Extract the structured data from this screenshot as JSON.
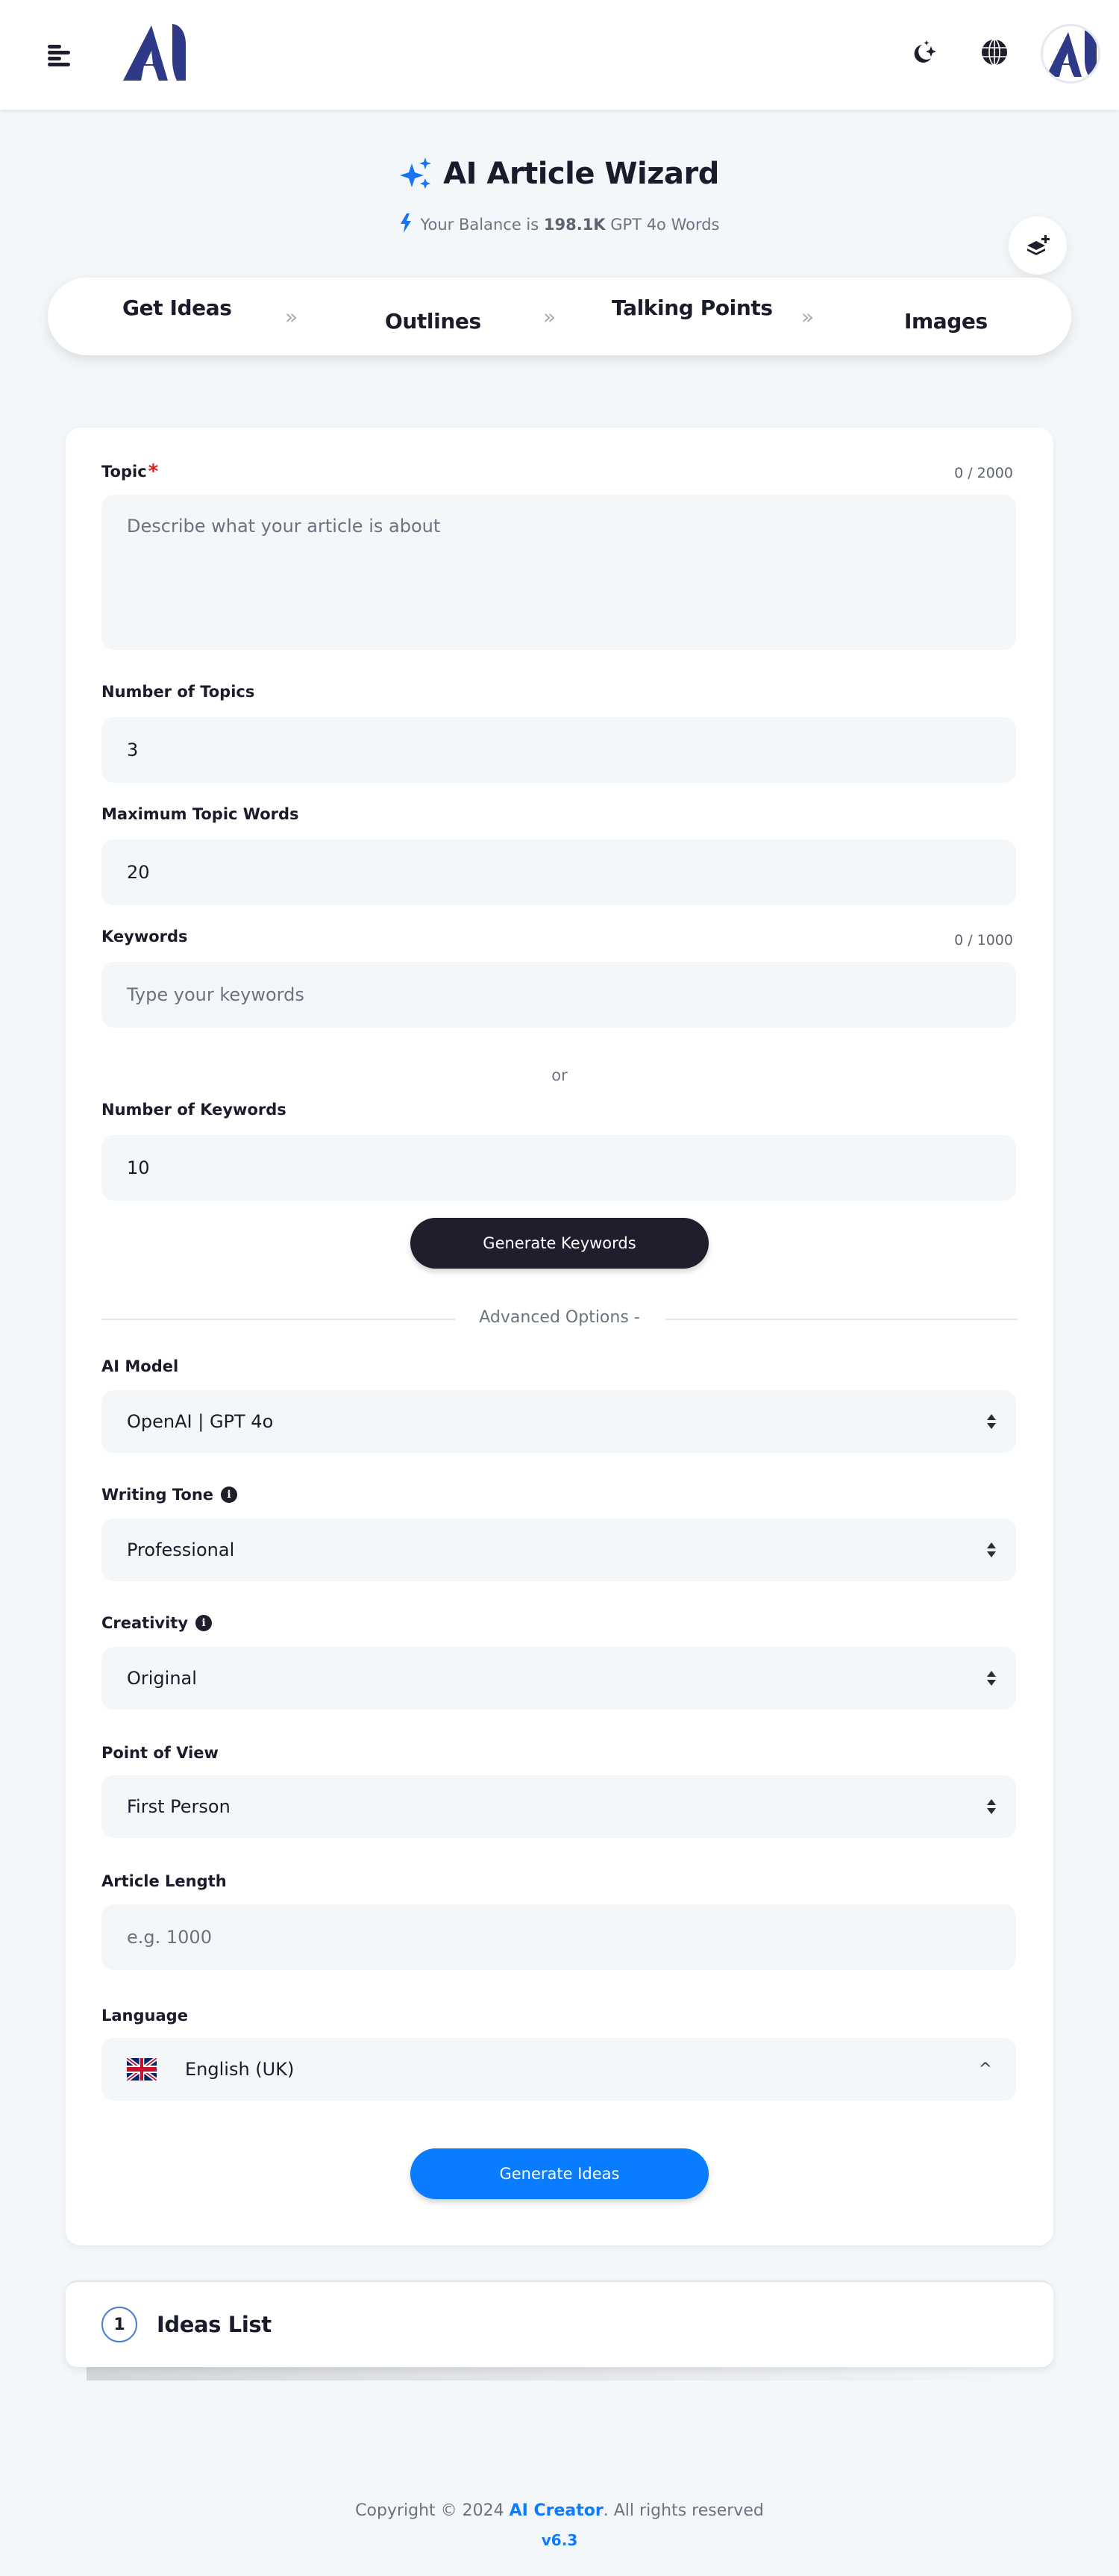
{
  "header": {
    "menu_icon": "hamburger-menu-icon",
    "logo": "ai-creator-logo",
    "theme_icon": "moon-stars-icon",
    "language_icon": "globe-icon",
    "avatar": "user-avatar"
  },
  "page": {
    "title": "AI Article Wizard",
    "title_icon": "sparkles-icon",
    "balance_prefix": "Your Balance is ",
    "balance_value": "198.1K",
    "balance_suffix": " GPT 4o Words",
    "balance_icon": "lightning-bolt-icon",
    "floating_button_icon": "layers-plus-icon"
  },
  "steps": [
    {
      "label": "Get Ideas"
    },
    {
      "label": "Outlines"
    },
    {
      "label": "Talking Points"
    },
    {
      "label": "Images"
    }
  ],
  "form": {
    "topic": {
      "label": "Topic",
      "required_mark": "*",
      "counter": "0 / 2000",
      "placeholder": "Describe what your article is about",
      "value": ""
    },
    "number_of_topics": {
      "label": "Number of Topics",
      "value": "3"
    },
    "max_topic_words": {
      "label": "Maximum Topic Words",
      "value": "20"
    },
    "keywords": {
      "label": "Keywords",
      "counter": "0 / 1000",
      "placeholder": "Type your keywords",
      "value": ""
    },
    "or_text": "or",
    "number_of_keywords": {
      "label": "Number of Keywords",
      "value": "10"
    },
    "generate_keywords_label": "Generate Keywords",
    "advanced_options_label": "Advanced Options -",
    "ai_model": {
      "label": "AI Model",
      "selected": "OpenAI | GPT 4o"
    },
    "writing_tone": {
      "label": "Writing Tone",
      "selected": "Professional"
    },
    "creativity": {
      "label": "Creativity",
      "selected": "Original"
    },
    "point_of_view": {
      "label": "Point of View",
      "selected": "First Person"
    },
    "article_length": {
      "label": "Article Length",
      "placeholder": "e.g. 1000",
      "value": ""
    },
    "language": {
      "label": "Language",
      "selected": "English (UK)",
      "flag": "uk-flag-icon"
    },
    "generate_ideas_label": "Generate Ideas",
    "info_glyph": "i"
  },
  "ideas_list": {
    "step_number": "1",
    "title": "Ideas List"
  },
  "footer": {
    "copyright_prefix": "Copyright © 2024 ",
    "brand": "AI Creator",
    "copyright_suffix": ". All rights reserved",
    "version": "v6.3"
  },
  "colors": {
    "brand_navy": "#2e3a87",
    "accent_blue": "#0a7cff",
    "dark_button": "#1e1e2d",
    "required_red": "#e21b1b",
    "input_bg": "#f3f7fa"
  }
}
